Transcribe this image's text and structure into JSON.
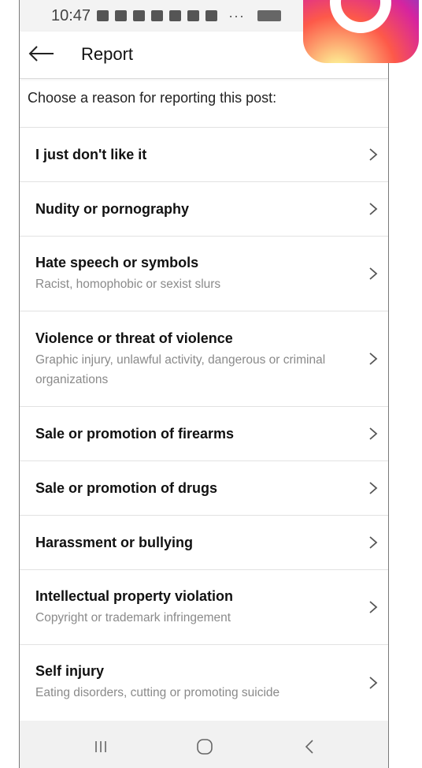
{
  "status_bar": {
    "time": "10:47",
    "dots": "···"
  },
  "header": {
    "title": "Report",
    "back_icon": "arrow-left-icon"
  },
  "prompt": "Choose a reason for reporting this post:",
  "reasons": [
    {
      "title": "I just don't like it",
      "subtitle": ""
    },
    {
      "title": "Nudity or pornography",
      "subtitle": ""
    },
    {
      "title": "Hate speech or symbols",
      "subtitle": "Racist, homophobic or sexist slurs"
    },
    {
      "title": "Violence or threat of violence",
      "subtitle": "Graphic injury, unlawful activity, dangerous or criminal organizations"
    },
    {
      "title": "Sale or promotion of firearms",
      "subtitle": ""
    },
    {
      "title": "Sale or promotion of drugs",
      "subtitle": ""
    },
    {
      "title": "Harassment or bullying",
      "subtitle": ""
    },
    {
      "title": "Intellectual property violation",
      "subtitle": "Copyright or trademark infringement"
    },
    {
      "title": "Self injury",
      "subtitle": "Eating disorders, cutting or promoting suicide"
    }
  ],
  "nav_bar": {
    "recents_icon": "recent-apps-icon",
    "home_icon": "home-icon",
    "back_icon": "back-chevron-icon"
  },
  "colors": {
    "text_primary": "#111111",
    "text_secondary": "#8a8a8a",
    "divider": "#e2e2e2",
    "nav_bg": "#f1f1f1"
  }
}
